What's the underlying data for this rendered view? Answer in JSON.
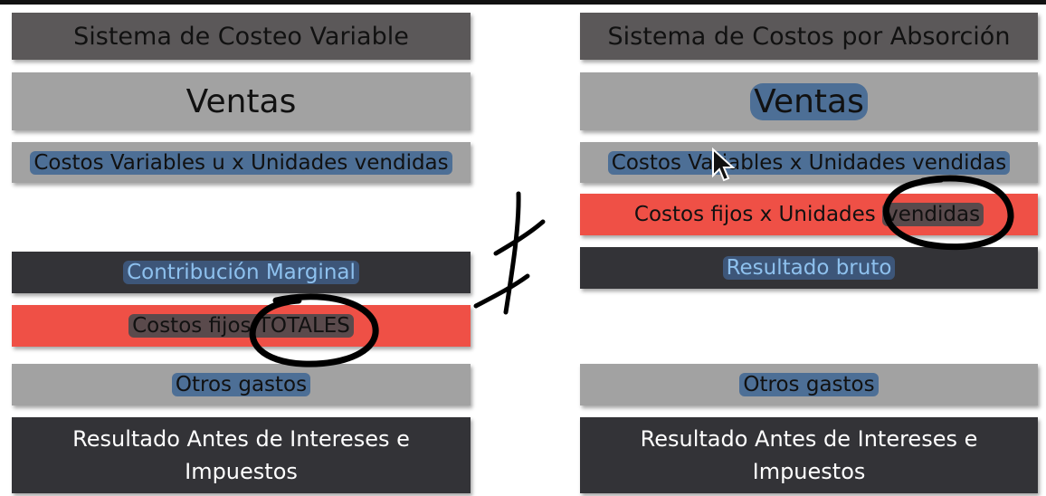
{
  "left": {
    "title": "Sistema de Costeo Variable",
    "ventas": "Ventas",
    "costos_variables": "Costos Variables u x Unidades vendidas",
    "contribucion": "Contribución Marginal",
    "costos_fijos_a": "Costos fijos",
    "costos_fijos_b": "TOTALES",
    "otros_gastos": "Otros gastos",
    "resultado_line1": "Resultado Antes de Intereses e",
    "resultado_line2": "Impuestos"
  },
  "right": {
    "title": "Sistema de Costos por Absorción",
    "ventas": "Ventas",
    "costos_variables": "Costos Variables x Unidades vendidas",
    "costos_fijos_a": "Costos fijos x Unidades ",
    "costos_fijos_b": "vendidas",
    "resultado_bruto": "Resultado bruto",
    "otros_gastos": "Otros gastos",
    "resultado_line1": "Resultado Antes de Intereses e",
    "resultado_line2": "Impuestos"
  },
  "colors": {
    "title_bg": "#5b5859",
    "gray_bg": "#a2a2a2",
    "dark_bg": "#333337",
    "red_bg": "#ef5046",
    "highlight": "#4d6f96",
    "ink": "#000000"
  },
  "icons": [
    "not-equal-icon",
    "mouse-cursor-icon"
  ]
}
